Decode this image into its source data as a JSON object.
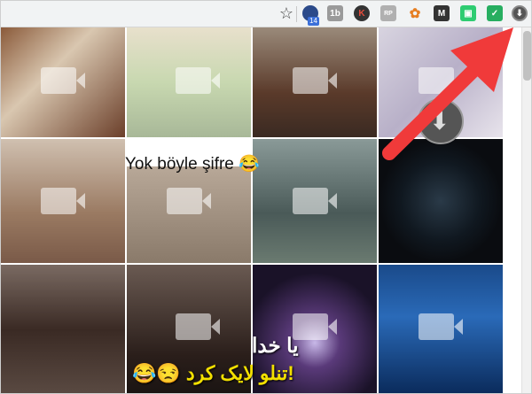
{
  "toolbar": {
    "star_icon": "star-icon",
    "extensions": [
      {
        "icon": "profile-extension-icon",
        "color": "#2b4a8a",
        "label": "",
        "badge": "14"
      },
      {
        "icon": "1b-extension-icon",
        "color": "#9a9a9a",
        "label": "1b"
      },
      {
        "icon": "k-extension-icon",
        "color": "#c0392b",
        "label": "K"
      },
      {
        "icon": "rp-extension-icon",
        "color": "#b0b0b0",
        "label": "RP"
      },
      {
        "icon": "gear-flower-extension-icon",
        "color": "#e67e22",
        "label": "✿"
      },
      {
        "icon": "m-extension-icon",
        "color": "#333333",
        "label": "M"
      },
      {
        "icon": "green-square-extension-icon",
        "color": "#2ecc71",
        "label": "▣"
      },
      {
        "icon": "checkmark-extension-icon",
        "color": "#27ae60",
        "label": "✓"
      },
      {
        "icon": "download-extension-icon",
        "color": "#555555",
        "label": "⬇"
      }
    ]
  },
  "grid": {
    "captions": {
      "turkish": "Yok böyle şifre 😂",
      "persian_line1": "یا خدا",
      "persian_line2": "😂😒 تنلو لایک کرد!"
    },
    "tiles": [
      {
        "name": "tile-dumplings",
        "color": "#b58a6a"
      },
      {
        "name": "tile-green-dress",
        "color": "#d6cfbe"
      },
      {
        "name": "tile-room-people",
        "color": "#6a4f3b"
      },
      {
        "name": "tile-blur-kitchen",
        "color": "#c8c3d0"
      },
      {
        "name": "tile-woman-face",
        "color": "#a88a78"
      },
      {
        "name": "tile-two-men",
        "color": "#c7b8a4"
      },
      {
        "name": "tile-forest-log",
        "color": "#6b7a78"
      },
      {
        "name": "tile-download-speaker",
        "color": "#0f1418"
      },
      {
        "name": "tile-theater-camera",
        "color": "#5a4a42"
      },
      {
        "name": "tile-woman-hijab",
        "color": "#3c2e28"
      },
      {
        "name": "tile-neon-palms",
        "color": "#2b2038"
      },
      {
        "name": "tile-man-stage",
        "color": "#1f4e8a"
      }
    ]
  },
  "annotation": {
    "arrow_icon": "red-arrow-annotation",
    "color": "#f03a3a"
  }
}
